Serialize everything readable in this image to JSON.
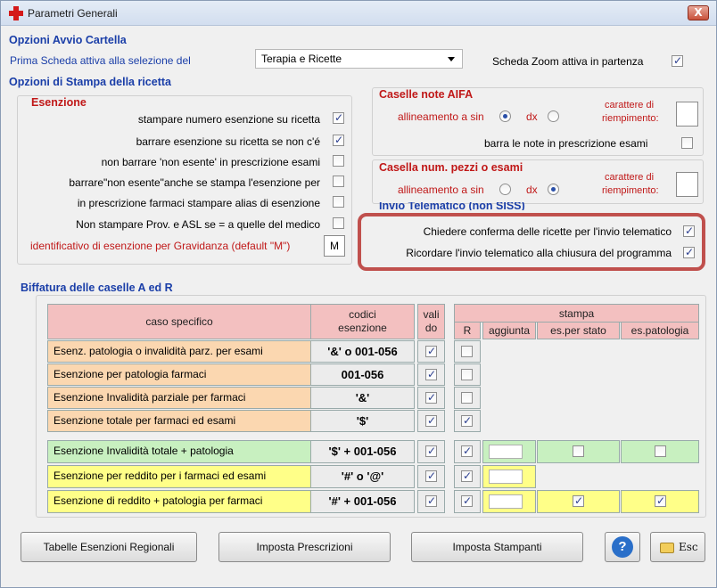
{
  "window": {
    "title": "Parametri Generali",
    "close_label": "X"
  },
  "avvio": {
    "heading": "Opzioni Avvio Cartella",
    "prima_scheda_label": "Prima Scheda attiva alla selezione del",
    "prima_scheda_value": "Terapia e Ricette",
    "zoom_label": "Scheda Zoom attiva in partenza",
    "zoom_checked": true
  },
  "stampa": {
    "heading": "Opzioni di Stampa della ricetta",
    "esenzione_heading": "Esenzione",
    "options": [
      {
        "label": "stampare numero esenzione su ricetta",
        "checked": true
      },
      {
        "label": "barrare esenzione su ricetta se non c'é",
        "checked": true
      },
      {
        "label": "non barrare 'non esente' in prescrizione esami",
        "checked": false
      },
      {
        "label": "barrare\"non esente\"anche se stampa l'esenzione per",
        "checked": false
      },
      {
        "label": "in prescrizione farmaci stampare alias di esenzione",
        "checked": false
      },
      {
        "label": "Non stampare Prov. e ASL se = a quelle del medico",
        "checked": false
      }
    ],
    "gravidanza_label": "identificativo di esenzione per Gravidanza (default \"M\")",
    "gravidanza_value": "M"
  },
  "aifa": {
    "heading": "Caselle note AIFA",
    "allineamento_label": "allineamento a sin",
    "dx_label": "dx",
    "sin_selected": true,
    "carattere_label_1": "carattere di",
    "carattere_label_2": "riempimento:",
    "barra_label": "barra le note in prescrizione esami",
    "barra_checked": false
  },
  "pezzi": {
    "heading": "Casella num. pezzi o esami",
    "allineamento_label": "allineamento a sin",
    "dx_label": "dx",
    "dx_selected": true,
    "carattere_label_1": "carattere di",
    "carattere_label_2": "riempimento:"
  },
  "telematico": {
    "heading": "Invio Telematico (non SISS)",
    "conferma_label": "Chiedere conferma delle ricette per l'invio telematico",
    "conferma_checked": true,
    "ricordare_label": "Ricordare l'invio telematico alla chiusura del programma",
    "ricordare_checked": true
  },
  "biffatura": {
    "heading": "Biffatura delle caselle A ed R",
    "headers": {
      "caso": "caso specifico",
      "codici_1": "codici",
      "codici_2": "esenzione",
      "valido_1": "vali",
      "valido_2": "do",
      "stampa": "stampa",
      "r": "R",
      "aggiunta": "aggiunta",
      "es_stato": "es.per stato",
      "es_patologia": "es.patologia"
    },
    "rows": [
      {
        "caso": "Esenz. patologia o invalidità parz. per esami",
        "codici": "'&' o 001-056",
        "valido": true,
        "r": false
      },
      {
        "caso": "Esenzione per patologia farmaci",
        "codici": "001-056",
        "valido": true,
        "r": false
      },
      {
        "caso": "Esenzione Invalidità parziale per farmaci",
        "codici": "'&'",
        "valido": true,
        "r": false
      },
      {
        "caso": "Esenzione totale per farmaci ed esami",
        "codici": "'$'",
        "valido": true,
        "r": true
      },
      {
        "caso": "Esenzione Invalidità totale + patologia",
        "codici": "'$' + 001-056",
        "valido": true,
        "r": true,
        "es_stato": false,
        "es_patologia": false
      },
      {
        "caso": "Esenzione per reddito per i farmaci ed esami",
        "codici": "'#'  o  '@'",
        "valido": true,
        "r": true
      },
      {
        "caso": "Esenzione di reddito + patologia per farmaci",
        "codici": "'#' + 001-056",
        "valido": true,
        "r": true,
        "es_stato": true,
        "es_patologia": true
      }
    ]
  },
  "buttons": {
    "tabelle": "Tabelle Esenzioni Regionali",
    "prescrizioni": "Imposta Prescrizioni",
    "stampanti": "Imposta Stampanti",
    "help": "?",
    "esc": "Esc"
  },
  "colors": {
    "accent_blue": "#1a3ea8",
    "heading_red": "#c01818",
    "highlight_border": "#c0504d",
    "row_orange": "#fbd7b0",
    "row_green": "#c8f0c0",
    "row_yellow": "#ffff88",
    "header_pink": "#f3c0c0"
  }
}
